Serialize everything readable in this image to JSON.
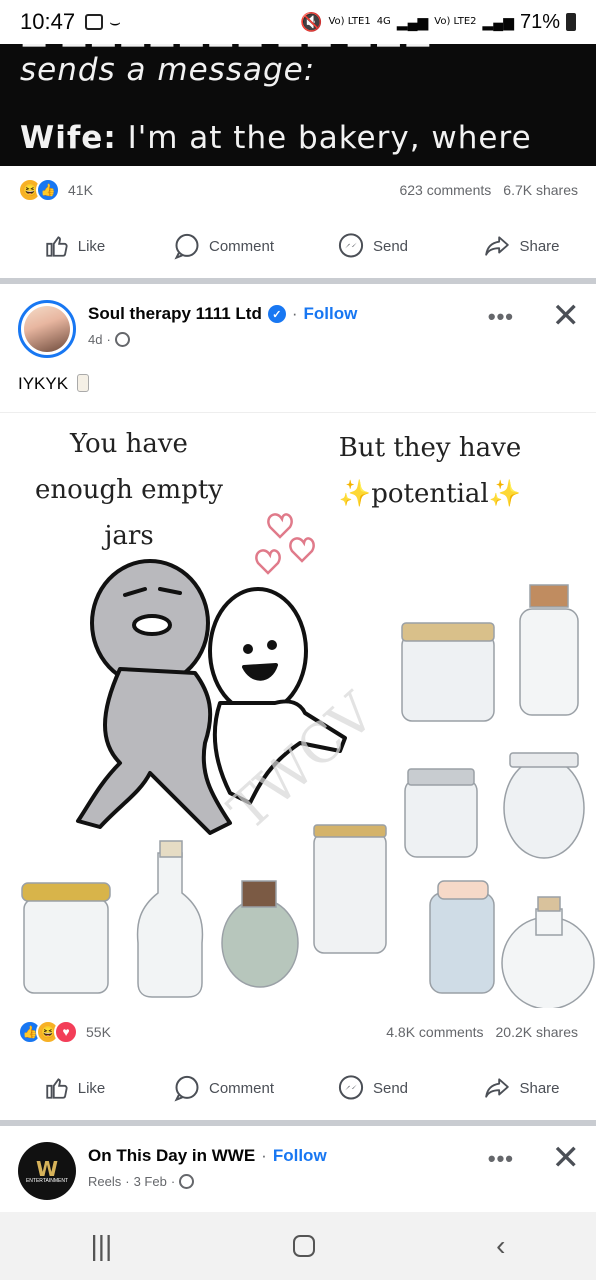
{
  "status_bar": {
    "time": "10:47",
    "signal_1_label": "Vo) LTE1",
    "signal_net": "4G",
    "signal_2_label": "Vo) LTE2",
    "battery": "71%"
  },
  "prev_post": {
    "image_text_line1": "sends a message:",
    "image_text_line2_bold": "Wife:",
    "image_text_line2": " I'm at the bakery, where",
    "reaction_count": "41K",
    "comments": "623 comments",
    "shares": "6.7K shares"
  },
  "actions": {
    "like": "Like",
    "comment": "Comment",
    "send": "Send",
    "share": "Share"
  },
  "post": {
    "page_name": "Soul therapy 1111 Ltd",
    "follow": "Follow",
    "time": "4d",
    "caption": "IYKYK",
    "meme": {
      "left_text_1": "You have",
      "left_text_2": "enough empty",
      "left_text_3": "jars",
      "right_text_1": "But they have",
      "right_text_2": "✨potential✨",
      "watermark": "TWCV"
    },
    "reaction_count": "55K",
    "comments": "4.8K comments",
    "shares": "20.2K shares"
  },
  "next_post": {
    "page_name": "On This Day in WWE",
    "follow": "Follow",
    "meta_type": "Reels",
    "time": "3 Feb",
    "avatar_text": "ENTERTAINMENT"
  },
  "colors": {
    "fb_blue": "#1877f2",
    "divider": "#c9ccd1",
    "muted": "#65676b"
  }
}
